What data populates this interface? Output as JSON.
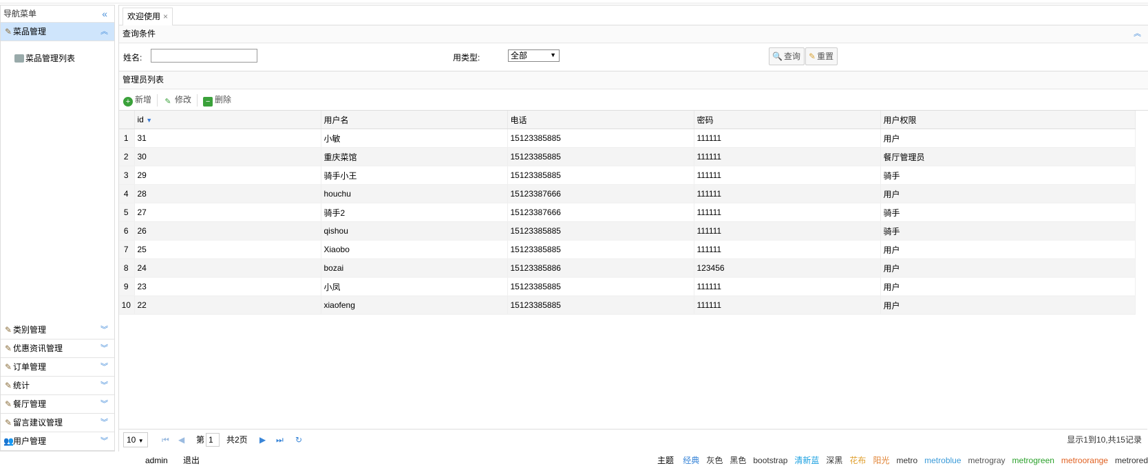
{
  "sidebar": {
    "title": "导航菜单",
    "collapse_icon": "«",
    "active_panel": {
      "label": "菜品管理",
      "items": [
        {
          "label": "菜品管理列表"
        }
      ]
    },
    "panels": [
      {
        "label": "类别管理"
      },
      {
        "label": "优惠资讯管理"
      },
      {
        "label": "订单管理"
      },
      {
        "label": "统计"
      },
      {
        "label": "餐厅管理"
      },
      {
        "label": "留言建议管理"
      },
      {
        "label": "用户管理"
      }
    ]
  },
  "tabs": [
    {
      "label": "欢迎使用",
      "close": "×"
    }
  ],
  "query": {
    "header": "查询条件",
    "name_label": "姓名:",
    "name_value": "",
    "type_label": "用类型:",
    "type_value": "全部",
    "search_label": "查询",
    "reset_label": "重置"
  },
  "grid": {
    "title": "管理员列表",
    "toolbar": {
      "add": "新增",
      "edit": "修改",
      "delete": "删除"
    },
    "columns": [
      "id",
      "用户名",
      "电话",
      "密码",
      "用户权限"
    ],
    "rows": [
      [
        "1",
        "31",
        "小敏",
        "15123385885",
        "111111",
        "用户"
      ],
      [
        "2",
        "30",
        "重庆菜馆",
        "15123385885",
        "111111",
        "餐厅管理员"
      ],
      [
        "3",
        "29",
        "骑手小王",
        "15123385885",
        "111111",
        "骑手"
      ],
      [
        "4",
        "28",
        "houchu",
        "15123387666",
        "111111",
        "用户"
      ],
      [
        "5",
        "27",
        "骑手2",
        "15123387666",
        "111111",
        "骑手"
      ],
      [
        "6",
        "26",
        "qishou",
        "15123385885",
        "111111",
        "骑手"
      ],
      [
        "7",
        "25",
        "Xiaobo",
        "15123385885",
        "111111",
        "用户"
      ],
      [
        "8",
        "24",
        "bozai",
        "15123385886",
        "123456",
        "用户"
      ],
      [
        "9",
        "23",
        "小凤",
        "15123385885",
        "111111",
        "用户"
      ],
      [
        "10",
        "22",
        "xiaofeng",
        "15123385885",
        "111111",
        "用户"
      ]
    ]
  },
  "pager": {
    "page_size": "10",
    "page_prefix": "第",
    "page_value": "1",
    "page_total": "共2页",
    "info": "显示1到10,共15记录"
  },
  "footer": {
    "user": "admin",
    "logout": "退出",
    "theme_label": "主题",
    "themes": [
      "经典",
      "灰色",
      "黑色",
      "bootstrap",
      "清新蓝",
      "深黑",
      "花布",
      "阳光",
      "metro",
      "metroblue",
      "metrogray",
      "metrogreen",
      "metroorange",
      "metrored"
    ]
  },
  "colors": {
    "accent": "#3a86d8",
    "active_panel_bg": "#cfe5fc"
  }
}
